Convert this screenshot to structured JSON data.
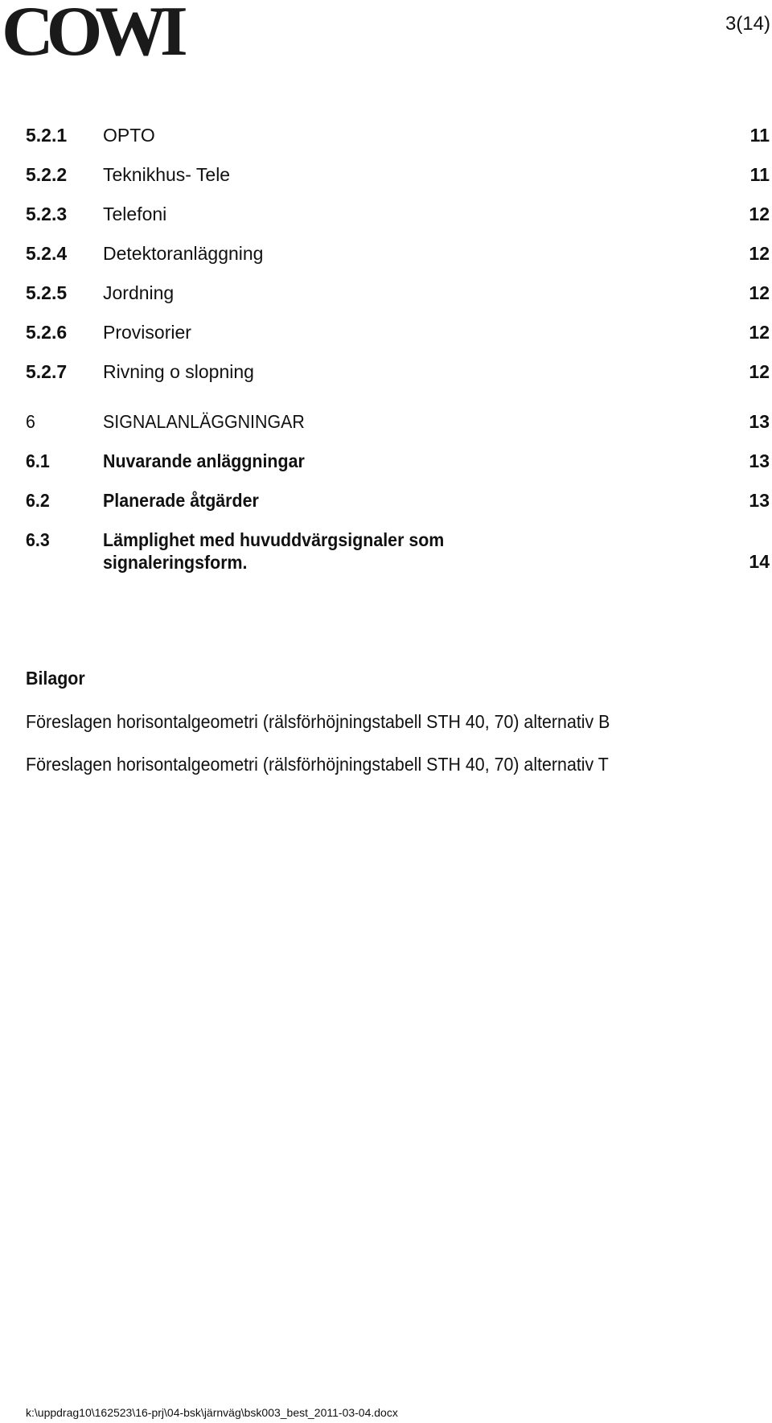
{
  "header": {
    "logo_text": "COWI",
    "page_indicator": "3(14)"
  },
  "toc": [
    {
      "number": "5.2.1",
      "title": "OPTO",
      "page": "11"
    },
    {
      "number": "5.2.2",
      "title": "Teknikhus- Tele",
      "page": "11"
    },
    {
      "number": "5.2.3",
      "title": "Telefoni",
      "page": "12"
    },
    {
      "number": "5.2.4",
      "title": "Detektoranläggning",
      "page": "12"
    },
    {
      "number": "5.2.5",
      "title": "Jordning",
      "page": "12"
    },
    {
      "number": "5.2.6",
      "title": "Provisorier",
      "page": "12"
    },
    {
      "number": "5.2.7",
      "title": "Rivning o slopning",
      "page": "12"
    },
    {
      "number": "6",
      "title": "SIGNALANLÄGGNINGAR",
      "page": "13"
    },
    {
      "number": "6.1",
      "title": "Nuvarande anläggningar",
      "page": "13"
    },
    {
      "number": "6.2",
      "title": "Planerade åtgärder",
      "page": "13"
    },
    {
      "number": "6.3",
      "title_line1": "Lämplighet med huvuddvärgsignaler som",
      "title_line2": "signaleringsform.",
      "page": "14"
    }
  ],
  "attachments": {
    "heading": "Bilagor",
    "items": [
      "Föreslagen horisontalgeometri (rälsförhöjningstabell STH 40, 70) alternativ B",
      "Föreslagen horisontalgeometri (rälsförhöjningstabell STH 40, 70) alternativ T"
    ]
  },
  "footer": {
    "file_path": "k:\\uppdrag10\\162523\\16-prj\\04-bsk\\järnväg\\bsk003_best_2011-03-04.docx"
  }
}
